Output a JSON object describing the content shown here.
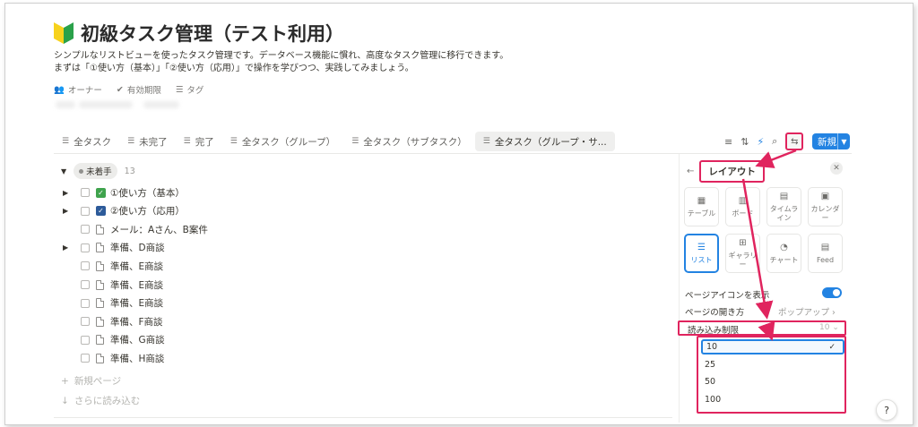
{
  "page": {
    "title": "初級タスク管理（テスト利用）",
    "desc1": "シンプルなリストビューを使ったタスク管理です。データベース機能に慣れ、高度なタスク管理に移行できます。",
    "desc2": "まずは「①使い方（基本）」「②使い方（応用）」で操作を学びつつ、実践してみましょう。"
  },
  "props": [
    {
      "icon": "people-icon",
      "label": "オーナー"
    },
    {
      "icon": "check-badge-icon",
      "label": "有効期限"
    },
    {
      "icon": "list-icon",
      "label": "タグ"
    }
  ],
  "tabs": [
    {
      "label": "全タスク"
    },
    {
      "label": "未完了"
    },
    {
      "label": "完了"
    },
    {
      "label": "全タスク（グループ）"
    },
    {
      "label": "全タスク（サブタスク）"
    },
    {
      "label": "全タスク（グループ・サ..."
    }
  ],
  "toolbar": {
    "new_label": "新規"
  },
  "group": {
    "label": "未着手",
    "count": "13"
  },
  "rows": [
    {
      "toggle": true,
      "icon": "green",
      "label": "①使い方（基本）"
    },
    {
      "toggle": true,
      "icon": "blue",
      "label": "②使い方（応用）"
    },
    {
      "toggle": false,
      "icon": "doc",
      "label": "メール：Aさん、B案件"
    },
    {
      "toggle": true,
      "icon": "doc",
      "label": "準備、D商談"
    },
    {
      "toggle": false,
      "icon": "doc",
      "label": "準備、E商談"
    },
    {
      "toggle": false,
      "icon": "doc",
      "label": "準備、E商談"
    },
    {
      "toggle": false,
      "icon": "doc",
      "label": "準備、E商談"
    },
    {
      "toggle": false,
      "icon": "doc",
      "label": "準備、F商談"
    },
    {
      "toggle": false,
      "icon": "doc",
      "label": "準備、G商談"
    },
    {
      "toggle": false,
      "icon": "doc",
      "label": "準備、H商談"
    }
  ],
  "footer": {
    "new_page": "新規ページ",
    "load_more": "さらに読み込む"
  },
  "panel": {
    "title": "レイアウト",
    "layouts": [
      {
        "icon": "table-icon",
        "label": "テーブル"
      },
      {
        "icon": "board-icon",
        "label": "ボード"
      },
      {
        "icon": "timeline-icon",
        "label": "タイムライン"
      },
      {
        "icon": "calendar-icon",
        "label": "カレンダー"
      },
      {
        "icon": "list-icon",
        "label": "リスト",
        "selected": true
      },
      {
        "icon": "gallery-icon",
        "label": "ギャラリー"
      },
      {
        "icon": "chart-icon",
        "label": "チャート"
      },
      {
        "icon": "feed-icon",
        "label": "Feed"
      }
    ],
    "show_icon_label": "ページアイコンを表示",
    "open_label": "ページの開き方",
    "open_value": "ポップアップ",
    "load_limit_label": "読み込み制限",
    "load_limit_value": "10",
    "options": [
      "10",
      "25",
      "50",
      "100"
    ],
    "selected_option": "10"
  },
  "colors": {
    "accent": "#2383e2",
    "highlight": "#e0245e"
  }
}
